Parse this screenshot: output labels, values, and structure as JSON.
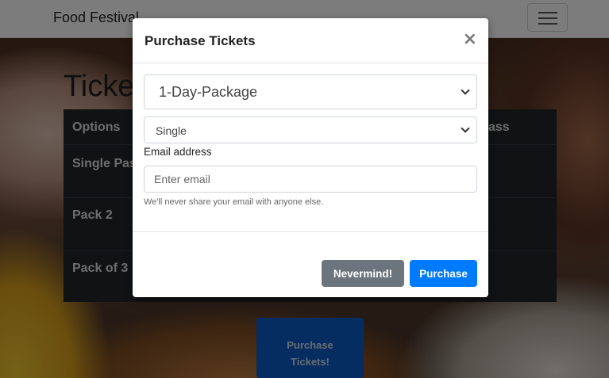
{
  "navbar": {
    "brand": "Food Festival"
  },
  "page": {
    "heading": "Ticke",
    "table": {
      "headers": [
        "Options",
        "ass"
      ],
      "rows": [
        "Single Pas",
        "Pack 2",
        "Pack of 3"
      ]
    },
    "purchase_button_line1": "Purchase",
    "purchase_button_line2": "Tickets!"
  },
  "modal": {
    "title": "Purchase Tickets",
    "close_label": "×",
    "package_select": {
      "selected": "1-Day-Package"
    },
    "type_select": {
      "selected": "Single"
    },
    "email_label": "Email address",
    "email_placeholder": "Enter email",
    "help_text": "We'll never share your email with anyone else.",
    "cancel_label": "Nevermind!",
    "purchase_label": "Purchase"
  },
  "colors": {
    "primary": "#007bff",
    "secondary": "#6c757d",
    "table_bg": "#212529"
  }
}
